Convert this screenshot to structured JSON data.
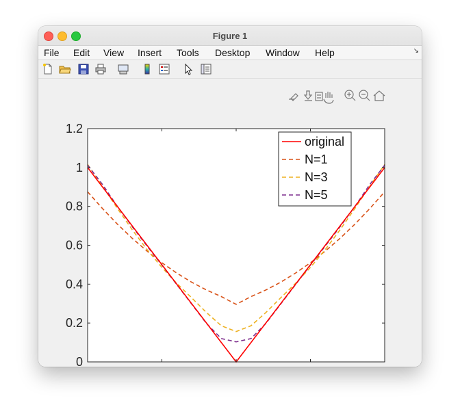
{
  "window": {
    "title": "Figure 1"
  },
  "menu": [
    "File",
    "Edit",
    "View",
    "Insert",
    "Tools",
    "Desktop",
    "Window",
    "Help"
  ],
  "toolbar_icons": [
    "new-figure-icon",
    "open-file-icon",
    "save-icon",
    "print-icon",
    "link-icon",
    "colorbar-icon",
    "legend-icon",
    "pointer-icon",
    "property-inspector-icon"
  ],
  "axes_toolbar_icons": [
    "brush-icon",
    "data-tips-icon",
    "restore-icon",
    "pan-icon",
    "zoom-in-icon",
    "zoom-out-icon",
    "home-icon"
  ],
  "chart_data": {
    "type": "line",
    "x": [
      -1,
      -0.9,
      -0.8,
      -0.7,
      -0.6,
      -0.5,
      -0.4,
      -0.3,
      -0.2,
      -0.1,
      0,
      0.1,
      0.2,
      0.3,
      0.4,
      0.5,
      0.6,
      0.7,
      0.8,
      0.9,
      1
    ],
    "xlim": [
      -1,
      1
    ],
    "ylim": [
      0,
      1.2
    ],
    "xticks": [
      "-1",
      "-0.5",
      "0",
      "0.5",
      "1"
    ],
    "yticks": [
      "0",
      "0.2",
      "0.4",
      "0.6",
      "0.8",
      "1",
      "1.2"
    ],
    "grid": false,
    "legend_position": "top-right",
    "series": [
      {
        "name": "original",
        "style": "solid",
        "color": "#ff0000",
        "values": [
          1,
          0.9,
          0.8,
          0.7,
          0.6,
          0.5,
          0.4,
          0.3,
          0.2,
          0.1,
          0,
          0.1,
          0.2,
          0.3,
          0.4,
          0.5,
          0.6,
          0.7,
          0.8,
          0.9,
          1
        ]
      },
      {
        "name": "N=1",
        "style": "dashed",
        "color": "#d95319",
        "values": [
          0.875,
          0.789,
          0.709,
          0.636,
          0.57,
          0.51,
          0.457,
          0.41,
          0.37,
          0.336,
          0.296,
          0.336,
          0.37,
          0.41,
          0.457,
          0.51,
          0.57,
          0.636,
          0.709,
          0.789,
          0.875
        ]
      },
      {
        "name": "N=3",
        "style": "dashed",
        "color": "#edb120",
        "values": [
          1.016,
          0.904,
          0.79,
          0.68,
          0.578,
          0.486,
          0.404,
          0.33,
          0.254,
          0.186,
          0.156,
          0.186,
          0.254,
          0.33,
          0.404,
          0.486,
          0.578,
          0.68,
          0.79,
          0.904,
          1.016
        ]
      },
      {
        "name": "N=5",
        "style": "dashed",
        "color": "#7e2f8e",
        "values": [
          1.012,
          0.913,
          0.8,
          0.696,
          0.596,
          0.498,
          0.398,
          0.298,
          0.198,
          0.12,
          0.103,
          0.12,
          0.198,
          0.298,
          0.398,
          0.498,
          0.596,
          0.696,
          0.8,
          0.913,
          1.012
        ]
      }
    ]
  }
}
